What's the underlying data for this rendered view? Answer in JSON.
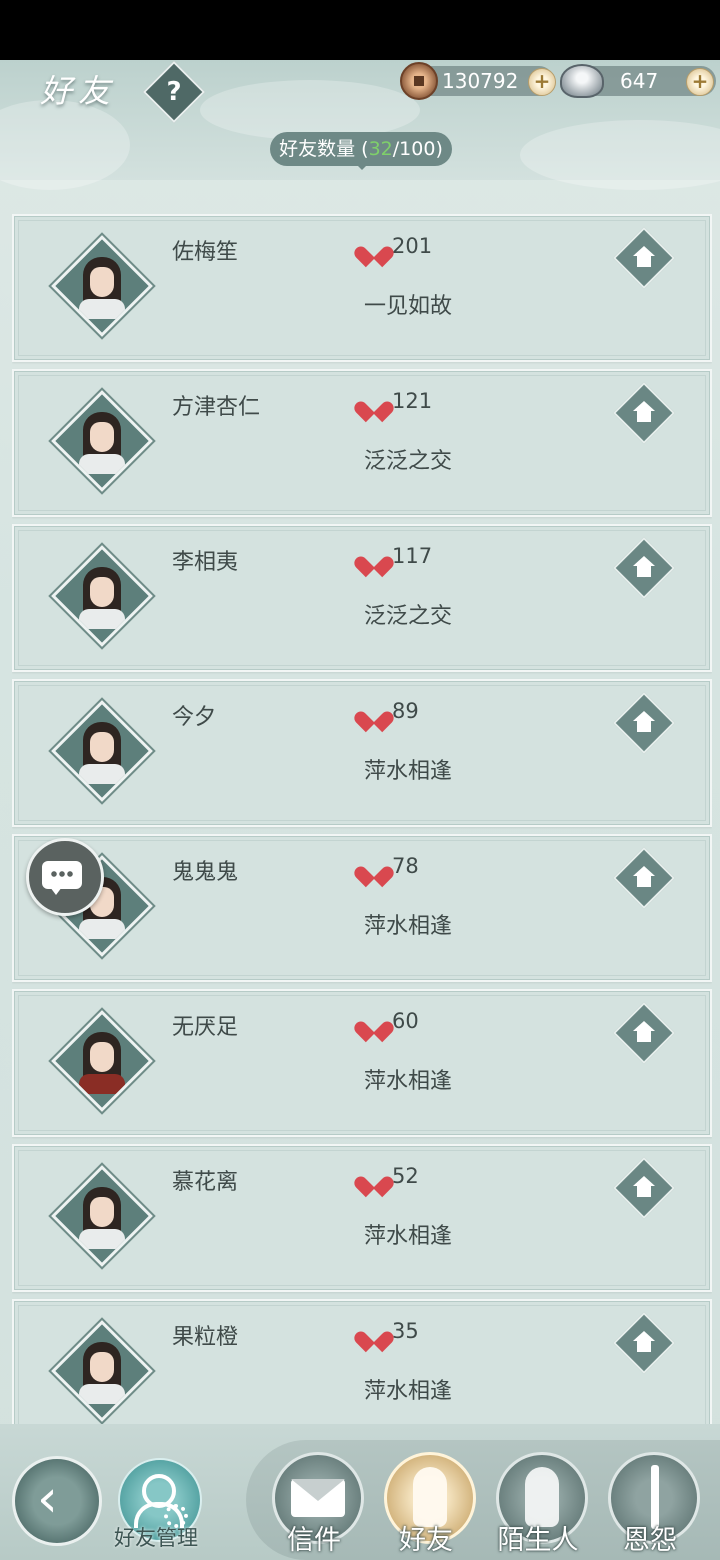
{
  "header": {
    "title": "好友",
    "help_label": "?",
    "coins": "130792",
    "silver": "647",
    "plus_label": "+",
    "friend_count_label": "好友数量",
    "friend_count_open": " (",
    "friend_count_current": "32",
    "friend_count_sep": "/100)"
  },
  "friends": [
    {
      "name": "佐梅笙",
      "score": "201",
      "relation": "一见如故"
    },
    {
      "name": "方津杏仁",
      "score": "121",
      "relation": "泛泛之交"
    },
    {
      "name": "李相夷",
      "score": "117",
      "relation": "泛泛之交"
    },
    {
      "name": "今夕",
      "score": "89",
      "relation": "萍水相逢"
    },
    {
      "name": "鬼鬼鬼",
      "score": "78",
      "relation": "萍水相逢"
    },
    {
      "name": "无厌足",
      "score": "60",
      "relation": "萍水相逢"
    },
    {
      "name": "慕花离",
      "score": "52",
      "relation": "萍水相逢"
    },
    {
      "name": "果粒橙",
      "score": "35",
      "relation": "萍水相逢"
    }
  ],
  "bottom": {
    "manage_label": "好友管理",
    "tabs": [
      {
        "label": "信件",
        "icon": "envelope-icon"
      },
      {
        "label": "好友",
        "icon": "friend-portrait-icon"
      },
      {
        "label": "陌生人",
        "icon": "stranger-portrait-icon"
      },
      {
        "label": "恩怨",
        "icon": "sword-icon"
      }
    ]
  },
  "colors": {
    "heart": "#d9484f",
    "count_green": "#7fd06a",
    "active_tab": "#c9a66a"
  }
}
